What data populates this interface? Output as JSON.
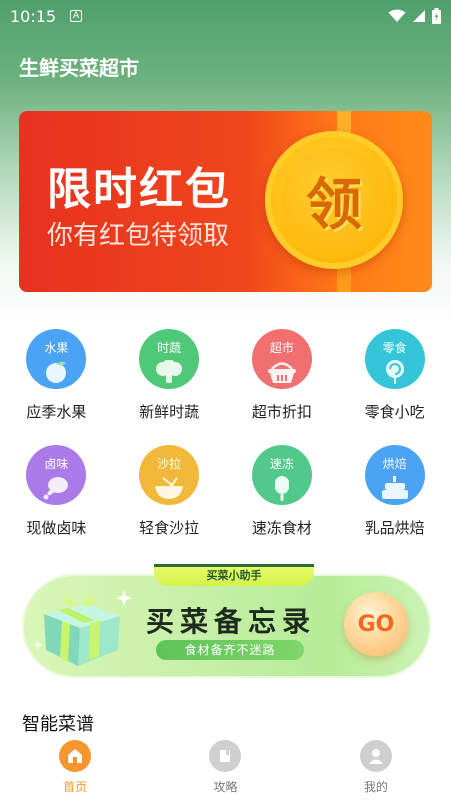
{
  "status_bar": {
    "time": "10:15",
    "notification_glyph": "A"
  },
  "header": {
    "title": "生鲜买菜超市"
  },
  "banner": {
    "title": "限时红包",
    "subtitle": "你有红包待领取",
    "coin_text": "领"
  },
  "categories": [
    {
      "tag": "水果",
      "label": "应季水果",
      "color": "#4aa3f3",
      "icon": "peach-icon"
    },
    {
      "tag": "时蔬",
      "label": "新鲜时蔬",
      "color": "#4fc878",
      "icon": "broccoli-icon"
    },
    {
      "tag": "超市",
      "label": "超市折扣",
      "color": "#f0706f",
      "icon": "basket-icon"
    },
    {
      "tag": "零食",
      "label": "零食小吃",
      "color": "#35c5d8",
      "icon": "lollipop-icon"
    },
    {
      "tag": "卤味",
      "label": "现做卤味",
      "color": "#a97ae8",
      "icon": "drumstick-icon"
    },
    {
      "tag": "沙拉",
      "label": "轻食沙拉",
      "color": "#f2b83a",
      "icon": "salad-bowl-icon"
    },
    {
      "tag": "速冻",
      "label": "速冻食材",
      "color": "#52c98a",
      "icon": "popsicle-icon"
    },
    {
      "tag": "烘焙",
      "label": "乳品烘焙",
      "color": "#4aa3f3",
      "icon": "cake-icon"
    }
  ],
  "promo": {
    "tab": "买菜小助手",
    "title": "买菜备忘录",
    "pill": "食材备齐不迷路",
    "go": "GO"
  },
  "section": {
    "title": "智能菜谱"
  },
  "nav": {
    "items": [
      {
        "label": "首页",
        "icon": "home-icon",
        "active": true
      },
      {
        "label": "攻略",
        "icon": "book-icon",
        "active": false
      },
      {
        "label": "我的",
        "icon": "user-icon",
        "active": false
      }
    ]
  },
  "colors": {
    "header_green": "#4fa06a",
    "banner_red": "#e6321f",
    "banner_orange": "#ff8a1a",
    "nav_active": "#f29a2e",
    "promo_green": "#c8f0a8"
  }
}
